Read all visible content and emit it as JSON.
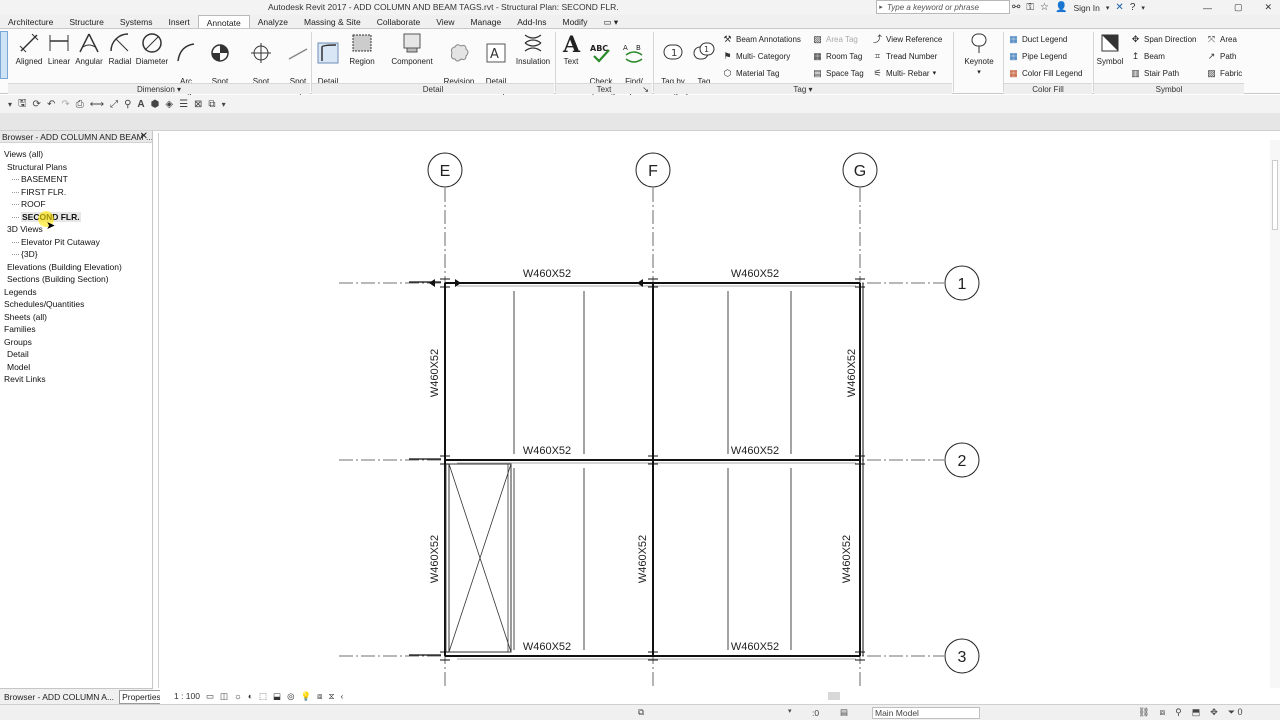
{
  "titlebar": {
    "title": "Autodesk Revit 2017 -    ADD COLUMN AND BEAM TAGS.rvt - Structural Plan: SECOND FLR.",
    "search_placeholder": "Type a keyword or phrase",
    "signin": "Sign In"
  },
  "ribbon_tabs": [
    "Architecture",
    "Structure",
    "Systems",
    "Insert",
    "Annotate",
    "Analyze",
    "Massing & Site",
    "Collaborate",
    "View",
    "Manage",
    "Add-Ins",
    "Modify"
  ],
  "active_tab": "Annotate",
  "ribbon": {
    "dimension": {
      "label": "Dimension",
      "tools": [
        "Aligned",
        "Linear",
        "Angular",
        "Radial",
        "Diameter",
        "Arc\nLength",
        "Spot\nElevation",
        "Spot\nCoordinate",
        "Spot\nSlope"
      ]
    },
    "detail": {
      "label": "Detail",
      "tools": [
        "Detail\nLine",
        "Region",
        "Component",
        "Revision\nCloud",
        "Detail\nGroup",
        "Insulation"
      ]
    },
    "text": {
      "label": "Text",
      "tools": [
        "Text",
        "Check\nSpelling",
        "Find/\nReplace"
      ]
    },
    "tag": {
      "label": "Tag",
      "big": [
        "Tag by\nCategory",
        "Tag\nAll"
      ],
      "col1": [
        "Beam  Annotations",
        "Multi- Category",
        "Material  Tag"
      ],
      "col2": [
        "Area  Tag",
        "Room  Tag",
        "Space  Tag"
      ],
      "col3": [
        "View Reference",
        "Tread  Number",
        "Multi- Rebar"
      ]
    },
    "keynote": "Keynote",
    "color_fill": {
      "label": "Color Fill",
      "items": [
        "Duct  Legend",
        "Pipe  Legend",
        "Color Fill  Legend"
      ]
    },
    "symbol": {
      "label": "Symbol",
      "big": "Symbol",
      "col1": [
        "Span Direction",
        "Beam",
        "Stair Path"
      ],
      "col2": [
        "Area",
        "Path",
        "Fabric"
      ]
    }
  },
  "browser": {
    "header": "Browser - ADD COLUMN AND BEAM ...",
    "tree": [
      {
        "label": "Views (all)",
        "level": 0
      },
      {
        "label": "Structural Plans",
        "level": 0.5
      },
      {
        "label": "BASEMENT",
        "level": 1
      },
      {
        "label": "FIRST FLR.",
        "level": 1
      },
      {
        "label": "ROOF",
        "level": 1
      },
      {
        "label": "SECOND FLR.",
        "level": 1,
        "selected": true
      },
      {
        "label": "3D Views",
        "level": 0.5
      },
      {
        "label": "Elevator Pit Cutaway",
        "level": 1
      },
      {
        "label": "{3D}",
        "level": 1
      },
      {
        "label": "Elevations (Building Elevation)",
        "level": 0.5
      },
      {
        "label": "Sections (Building Section)",
        "level": 0.5
      },
      {
        "label": "Legends",
        "level": 0
      },
      {
        "label": "Schedules/Quantities",
        "level": 0
      },
      {
        "label": "Sheets (all)",
        "level": 0
      },
      {
        "label": "Families",
        "level": 0
      },
      {
        "label": "Groups",
        "level": 0
      },
      {
        "label": "Detail",
        "level": 0.5
      },
      {
        "label": "Model",
        "level": 0.5
      },
      {
        "label": "Revit Links",
        "level": 0
      }
    ]
  },
  "bottom_tabs": [
    "Browser - ADD COLUMN A...",
    "Properties"
  ],
  "view_scale": "1 : 100",
  "status": {
    "coords": ":0",
    "model": "Main Model"
  },
  "plan": {
    "grid_columns": [
      "E",
      "F",
      "G"
    ],
    "grid_rows": [
      "1",
      "2",
      "3"
    ],
    "beam_label": "W460X52"
  }
}
